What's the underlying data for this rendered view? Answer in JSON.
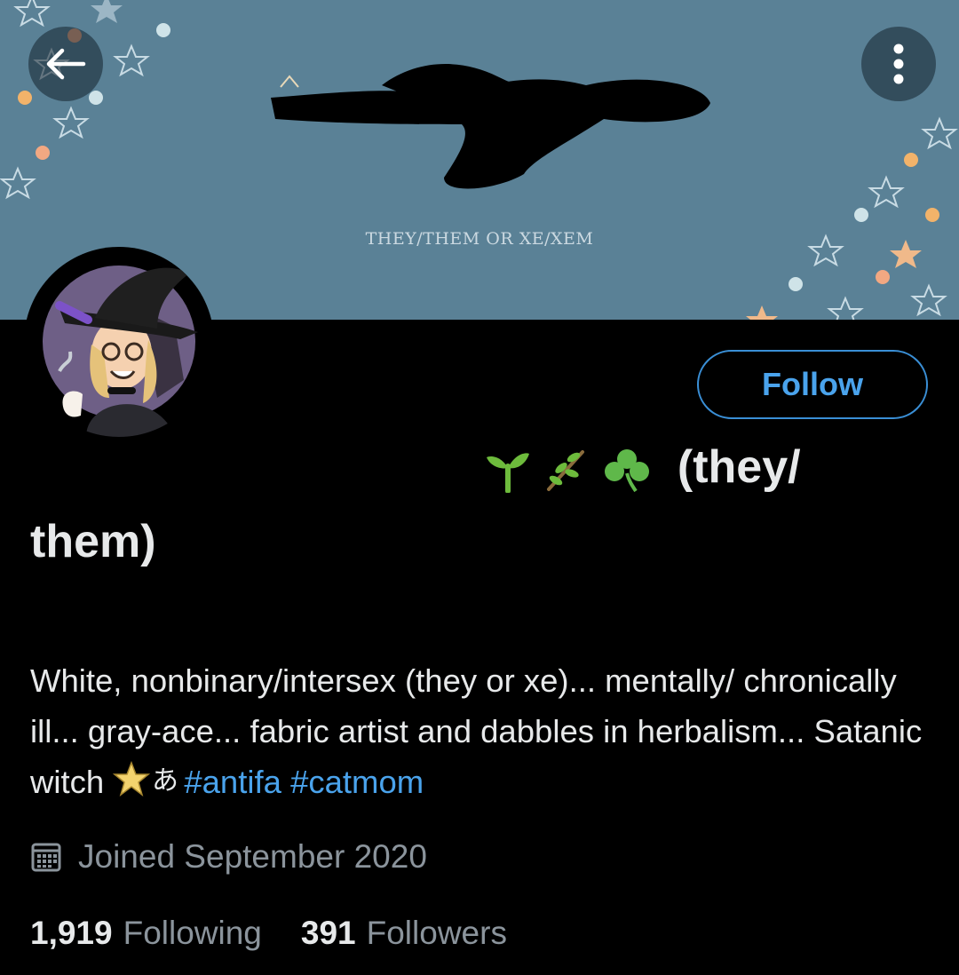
{
  "banner": {
    "caption": "THEY/THEM OR XE/XEM",
    "background_color": "#5a8196"
  },
  "header": {
    "back_icon": "arrow-left-icon",
    "more_icon": "more-vertical-icon"
  },
  "profile": {
    "name_emojis": [
      "seedling-icon",
      "herb-icon",
      "shamrock-icon"
    ],
    "name_suffix_line1": "(they/",
    "name_suffix_line2": "them)",
    "follow_label": "Follow",
    "bio_text": "White, nonbinary/intersex (they or xe)... mentally/ chronically ill... gray-ace... fabric artist and dabbles in herbalism... Satanic witch ",
    "bio_emojis": [
      "pentagram-icon",
      "hiragana-a-icon"
    ],
    "hashtags": [
      "#antifa",
      "#catmom"
    ],
    "joined": "Joined September 2020",
    "following_count": "1,919",
    "following_label": "Following",
    "followers_count": "391",
    "followers_label": "Followers"
  },
  "colors": {
    "accent": "#4aa3ec",
    "muted_text": "#8b949c",
    "primary_text": "#e7e9ea",
    "background": "#000000"
  }
}
